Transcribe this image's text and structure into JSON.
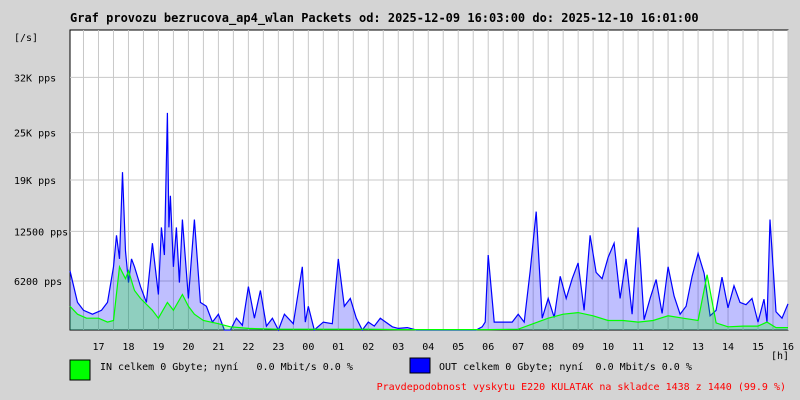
{
  "chart_data": {
    "type": "area",
    "title": "Graf provozu bezrucova_ap4_wlan Packets od: 2025-12-09 16:03:00 do: 2025-12-10 16:01:00",
    "ylabel": "[/s]",
    "xlabel": "[h]",
    "ylim": [
      0,
      38000
    ],
    "yticks": [
      {
        "value": 6200,
        "label": "6200 pps"
      },
      {
        "value": 12500,
        "label": "12500 pps"
      },
      {
        "value": 19000,
        "label": "19K pps"
      },
      {
        "value": 25000,
        "label": "25K pps"
      },
      {
        "value": 32000,
        "label": "32K pps"
      }
    ],
    "xlim": [
      16.05,
      40.0
    ],
    "xticks": [
      {
        "value": 17,
        "label": "17"
      },
      {
        "value": 18,
        "label": "18"
      },
      {
        "value": 19,
        "label": "19"
      },
      {
        "value": 20,
        "label": "20"
      },
      {
        "value": 21,
        "label": "21"
      },
      {
        "value": 22,
        "label": "22"
      },
      {
        "value": 23,
        "label": "23"
      },
      {
        "value": 24,
        "label": "00"
      },
      {
        "value": 25,
        "label": "01"
      },
      {
        "value": 26,
        "label": "02"
      },
      {
        "value": 27,
        "label": "03"
      },
      {
        "value": 28,
        "label": "04"
      },
      {
        "value": 29,
        "label": "05"
      },
      {
        "value": 30,
        "label": "06"
      },
      {
        "value": 31,
        "label": "07"
      },
      {
        "value": 32,
        "label": "08"
      },
      {
        "value": 33,
        "label": "09"
      },
      {
        "value": 34,
        "label": "10"
      },
      {
        "value": 35,
        "label": "11"
      },
      {
        "value": 36,
        "label": "12"
      },
      {
        "value": 37,
        "label": "13"
      },
      {
        "value": 38,
        "label": "14"
      },
      {
        "value": 39,
        "label": "15"
      },
      {
        "value": 40,
        "label": "16"
      }
    ],
    "grid": true,
    "series": [
      {
        "name": "OUT celkem 0 Gbyte; nyní 0.0 Mbit/s 0.0 %",
        "color": "#0000ff",
        "x": [
          16.05,
          16.3,
          16.5,
          16.8,
          17.1,
          17.3,
          17.5,
          17.6,
          17.7,
          17.8,
          17.9,
          18.0,
          18.1,
          18.2,
          18.4,
          18.6,
          18.8,
          19.0,
          19.1,
          19.2,
          19.3,
          19.35,
          19.4,
          19.5,
          19.6,
          19.7,
          19.8,
          20.0,
          20.2,
          20.4,
          20.6,
          20.8,
          21.0,
          21.2,
          21.4,
          21.6,
          21.8,
          22.0,
          22.2,
          22.4,
          22.6,
          22.8,
          23.0,
          23.2,
          23.5,
          23.8,
          23.9,
          24.0,
          24.2,
          24.5,
          24.8,
          25.0,
          25.2,
          25.4,
          25.6,
          25.8,
          26.0,
          26.2,
          26.4,
          26.8,
          27.0,
          27.3,
          27.6,
          28.0,
          28.4,
          28.8,
          29.2,
          29.6,
          29.8,
          29.9,
          30.0,
          30.2,
          30.5,
          30.8,
          31.0,
          31.2,
          31.4,
          31.6,
          31.8,
          32.0,
          32.2,
          32.4,
          32.6,
          32.8,
          33.0,
          33.2,
          33.4,
          33.6,
          33.8,
          34.0,
          34.2,
          34.4,
          34.6,
          34.8,
          35.0,
          35.2,
          35.4,
          35.6,
          35.8,
          36.0,
          36.2,
          36.4,
          36.6,
          36.8,
          37.0,
          37.2,
          37.4,
          37.6,
          37.8,
          38.0,
          38.2,
          38.4,
          38.6,
          38.8,
          39.0,
          39.2,
          39.3,
          39.4,
          39.6,
          39.8,
          40.0
        ],
        "values": [
          7500,
          3500,
          2500,
          2000,
          2500,
          3500,
          8000,
          12000,
          9000,
          20000,
          10000,
          6000,
          9000,
          8000,
          5500,
          3500,
          11000,
          4500,
          13000,
          9500,
          27500,
          13000,
          17000,
          8000,
          13000,
          6000,
          14000,
          4000,
          14000,
          3500,
          3000,
          1000,
          2000,
          0,
          0,
          1500,
          600,
          5500,
          1500,
          5000,
          500,
          1500,
          0,
          2000,
          800,
          8000,
          1000,
          3000,
          0,
          1000,
          800,
          9000,
          3000,
          4000,
          1500,
          0,
          1000,
          500,
          1500,
          400,
          200,
          300,
          0,
          0,
          0,
          0,
          0,
          0,
          400,
          1000,
          9500,
          1000,
          1000,
          1000,
          2000,
          1000,
          7500,
          15000,
          1500,
          4000,
          1600,
          6800,
          4000,
          6500,
          8500,
          2500,
          12000,
          7300,
          6500,
          9200,
          11000,
          4000,
          9000,
          2000,
          13000,
          1300,
          4000,
          6400,
          2100,
          8000,
          4300,
          2000,
          3000,
          6800,
          9700,
          7200,
          1800,
          2500,
          6700,
          2800,
          5600,
          3500,
          3200,
          4000,
          1000,
          3900,
          1000,
          14000,
          2300,
          1500,
          3300
        ]
      },
      {
        "name": "IN celkem 0 Gbyte; nyní 0.0 Mbit/s 0.0 %",
        "color": "#00ff00",
        "x": [
          16.05,
          16.3,
          16.6,
          17.0,
          17.3,
          17.5,
          17.7,
          17.9,
          18.0,
          18.2,
          18.4,
          18.8,
          19.0,
          19.3,
          19.5,
          19.8,
          20.0,
          20.2,
          20.5,
          21.0,
          21.4,
          22.0,
          23.0,
          24.0,
          25.0,
          26.0,
          27.0,
          28.0,
          30.0,
          31.0,
          31.5,
          32.0,
          32.5,
          33.0,
          33.5,
          34.0,
          34.5,
          35.0,
          35.5,
          36.0,
          36.5,
          37.0,
          37.3,
          37.6,
          38.0,
          38.5,
          39.0,
          39.3,
          39.6,
          40.0
        ],
        "values": [
          3000,
          2000,
          1500,
          1500,
          1000,
          1200,
          8000,
          6500,
          7500,
          5000,
          4000,
          2500,
          1500,
          3500,
          2500,
          4500,
          3000,
          2000,
          1200,
          800,
          400,
          200,
          100,
          100,
          100,
          100,
          50,
          50,
          50,
          100,
          800,
          1500,
          2000,
          2200,
          1800,
          1200,
          1200,
          1000,
          1200,
          1800,
          1500,
          1200,
          7000,
          900,
          400,
          500,
          500,
          1000,
          300,
          300
        ]
      }
    ]
  },
  "legend": {
    "out": {
      "label": "OUT celkem 0 Gbyte; nyní  0.0 Mbit/s 0.0 %",
      "color": "#0000ff"
    },
    "in": {
      "label": "IN celkem 0 Gbyte; nyní   0.0 Mbit/s 0.0 %",
      "color": "#00ff00"
    }
  },
  "footer": {
    "note": "Pravdepodobnost vyskytu E220 KULATAK na skladce 1438 z 1440 (99.9 %)",
    "color": "#ff0000"
  }
}
